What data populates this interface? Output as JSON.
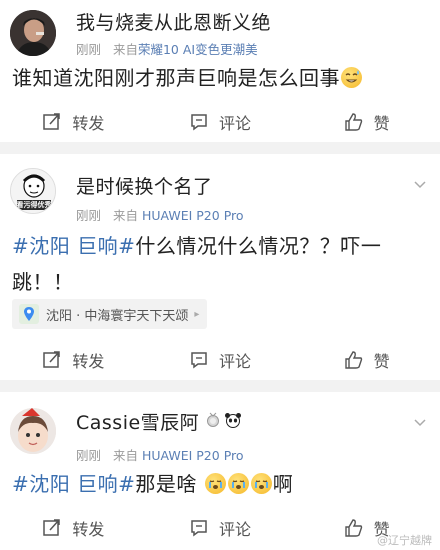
{
  "posts": [
    {
      "user": "我与烧麦从此恩断义绝",
      "time": "刚刚",
      "source_prefix": "来自",
      "source": "荣耀10 AI变色更潮美",
      "text_plain": "谁知道沈阳刚才那声巨响是怎么回事",
      "actions": {
        "repost": "转发",
        "comment": "评论",
        "like": "赞"
      }
    },
    {
      "user": "是时候换个名了",
      "avatar_caption": "看污得优秀",
      "time": "刚刚",
      "source_prefix": "来自",
      "source": "HUAWEI P20 Pro",
      "hashtag1": "#沈阳 巨响#",
      "text_line1": "什么情况什么情况？？吓一",
      "text_line2": "跳！！",
      "location": "沈阳 · 中海寰宇天下天颂",
      "actions": {
        "repost": "转发",
        "comment": "评论",
        "like": "赞"
      }
    },
    {
      "user": "Cassie雪辰阿",
      "time": "刚刚",
      "source_prefix": "来自",
      "source": "HUAWEI P20 Pro",
      "hashtag1": "#沈阳 巨响#",
      "text_mid": "那是啥",
      "text_end": "啊",
      "actions": {
        "repost": "转发",
        "comment": "评论",
        "like": "赞"
      }
    }
  ],
  "watermark": "@辽宁越牌",
  "colors": {
    "link": "#3b6fb0",
    "source": "#5b7fb4",
    "meta": "#9a9a9a"
  },
  "icons": [
    "chevron-down-icon",
    "repost-icon",
    "comment-icon",
    "like-icon",
    "location-pin-icon",
    "emoji-icon"
  ]
}
